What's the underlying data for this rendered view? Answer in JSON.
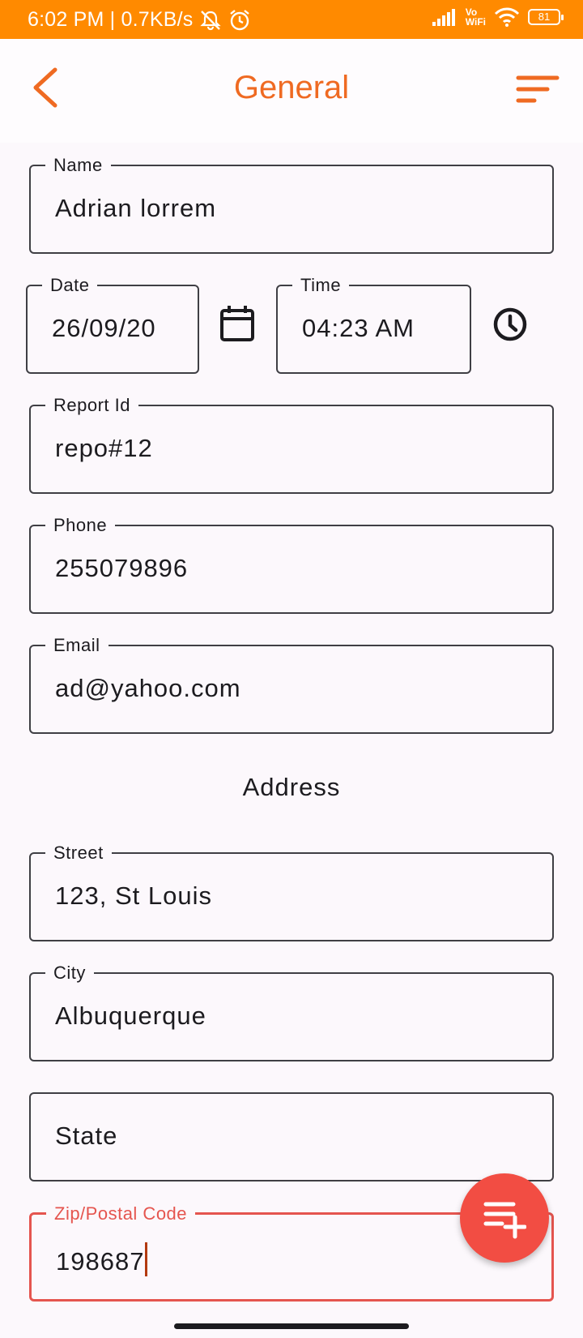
{
  "status_bar": {
    "time_speed": "6:02 PM | 0.7KB/s",
    "vowifi": "Vo\nWiFi",
    "battery": "81"
  },
  "app_bar": {
    "title": "General"
  },
  "fields": {
    "name": {
      "label": "Name",
      "value": "Adrian lorrem"
    },
    "date": {
      "label": "Date",
      "value": "26/09/20"
    },
    "time": {
      "label": "Time",
      "value": "04:23 AM"
    },
    "report_id": {
      "label": "Report Id",
      "value": "repo#12"
    },
    "phone": {
      "label": "Phone",
      "value": "255079896"
    },
    "email": {
      "label": "Email",
      "value": "ad@yahoo.com"
    },
    "street": {
      "label": "Street",
      "value": "123, St Louis"
    },
    "city": {
      "label": "City",
      "value": "Albuquerque"
    },
    "state": {
      "placeholder": "State"
    },
    "zip": {
      "label": "Zip/Postal Code",
      "value": "198687"
    }
  },
  "sections": {
    "address": "Address"
  },
  "colors": {
    "status_bar": "#ff8a00",
    "accent": "#ef6a22",
    "error": "#e5554f",
    "fab": "#f24d43"
  },
  "icons": [
    "back-icon",
    "sort-icon",
    "calendar-icon",
    "clock-icon",
    "playlist-add-icon"
  ]
}
